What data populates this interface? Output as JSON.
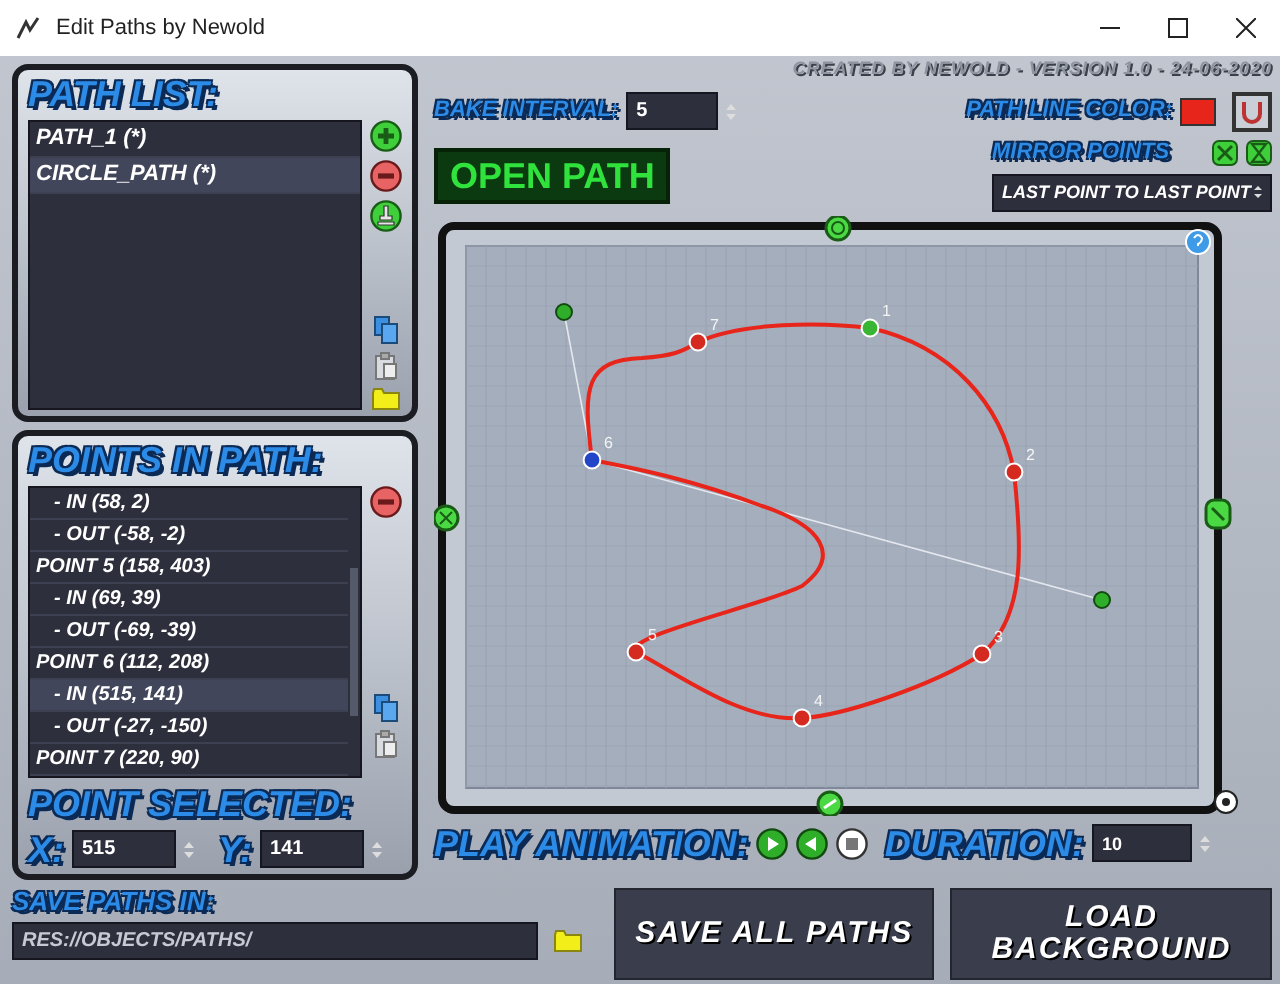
{
  "window": {
    "title": "Edit Paths by Newold"
  },
  "credit": "CREATED BY NEWOLD - VERSION 1.0 - 24-06-2020",
  "path_list": {
    "title": "PATH LIST:",
    "items": [
      {
        "label": "PATH_1 (*)",
        "selected": false
      },
      {
        "label": "CIRCLE_PATH (*)",
        "selected": true
      }
    ]
  },
  "points_in_path": {
    "title": "POINTS IN PATH:",
    "items": [
      {
        "label": "- IN (58, 2)",
        "kind": "handle",
        "selected": false
      },
      {
        "label": "- OUT (-58, -2)",
        "kind": "handle",
        "selected": false
      },
      {
        "label": "POINT 5 (158, 403)",
        "kind": "point",
        "selected": false
      },
      {
        "label": "- IN (69, 39)",
        "kind": "handle",
        "selected": false
      },
      {
        "label": "- OUT (-69, -39)",
        "kind": "handle",
        "selected": false
      },
      {
        "label": "POINT 6 (112, 208)",
        "kind": "point",
        "selected": false
      },
      {
        "label": "- IN (515, 141)",
        "kind": "handle",
        "selected": true
      },
      {
        "label": "- OUT (-27, -150)",
        "kind": "handle",
        "selected": false
      },
      {
        "label": "POINT 7 (220, 90)",
        "kind": "point",
        "selected": false
      }
    ]
  },
  "point_selected": {
    "title": "POINT SELECTED:",
    "x_label": "X:",
    "x_value": "515",
    "y_label": "Y:",
    "y_value": "141"
  },
  "save_paths": {
    "label": "SAVE PATHS IN:",
    "value": "RES://OBJECTS/PATHS/"
  },
  "bake_interval": {
    "label": "BAKE INTERVAL:",
    "value": "5"
  },
  "path_line_color": {
    "label": "PATH LINE COLOR:",
    "color": "#e8251a"
  },
  "open_path_button": "OPEN PATH",
  "mirror_points": {
    "label": "MIRROR POINTS",
    "mode": "LAST POINT TO LAST POINT"
  },
  "canvas": {
    "points": [
      {
        "label": "1",
        "kind": "start",
        "selected": false
      },
      {
        "label": "2",
        "kind": "normal",
        "selected": false
      },
      {
        "label": "3",
        "kind": "normal",
        "selected": false
      },
      {
        "label": "4",
        "kind": "normal",
        "selected": false
      },
      {
        "label": "5",
        "kind": "normal",
        "selected": false
      },
      {
        "label": "6",
        "kind": "normal",
        "selected": true
      },
      {
        "label": "7",
        "kind": "normal",
        "selected": false
      }
    ]
  },
  "play_animation": {
    "label": "PLAY ANIMATION:"
  },
  "duration": {
    "label": "DURATION:",
    "value": "10"
  },
  "buttons": [
    "SAVE ALL PATHS",
    "LOAD BACKGROUND"
  ]
}
